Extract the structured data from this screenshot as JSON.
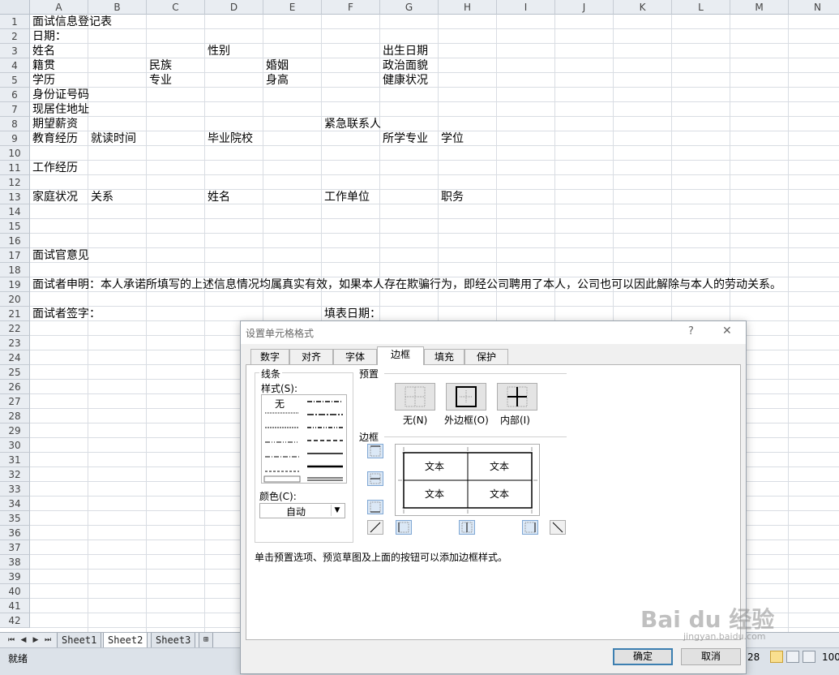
{
  "columns": [
    "A",
    "B",
    "C",
    "D",
    "E",
    "F",
    "G",
    "H",
    "I",
    "J",
    "K",
    "L",
    "M",
    "N"
  ],
  "rows": [
    "1",
    "2",
    "3",
    "4",
    "5",
    "6",
    "7",
    "8",
    "9",
    "10",
    "11",
    "12",
    "13",
    "14",
    "15",
    "16",
    "17",
    "18",
    "19",
    "20",
    "21",
    "22",
    "23",
    "24",
    "25",
    "26",
    "27",
    "28",
    "29",
    "30",
    "31",
    "32",
    "33",
    "34",
    "35",
    "36",
    "37",
    "38",
    "39",
    "40",
    "41",
    "42"
  ],
  "cells": [
    {
      "r": 1,
      "c": "A",
      "v": "面试信息登记表"
    },
    {
      "r": 2,
      "c": "A",
      "v": "日期："
    },
    {
      "r": 3,
      "c": "A",
      "v": "姓名"
    },
    {
      "r": 3,
      "c": "D",
      "v": "性别"
    },
    {
      "r": 3,
      "c": "G",
      "v": "出生日期"
    },
    {
      "r": 4,
      "c": "A",
      "v": "籍贯"
    },
    {
      "r": 4,
      "c": "C",
      "v": "民族"
    },
    {
      "r": 4,
      "c": "E",
      "v": "婚姻"
    },
    {
      "r": 4,
      "c": "G",
      "v": "政治面貌"
    },
    {
      "r": 5,
      "c": "A",
      "v": "学历"
    },
    {
      "r": 5,
      "c": "C",
      "v": "专业"
    },
    {
      "r": 5,
      "c": "E",
      "v": "身高"
    },
    {
      "r": 5,
      "c": "G",
      "v": "健康状况"
    },
    {
      "r": 6,
      "c": "A",
      "v": "身份证号码"
    },
    {
      "r": 7,
      "c": "A",
      "v": "现居住地址"
    },
    {
      "r": 8,
      "c": "A",
      "v": "期望薪资"
    },
    {
      "r": 8,
      "c": "F",
      "v": "紧急联系人"
    },
    {
      "r": 9,
      "c": "A",
      "v": "教育经历"
    },
    {
      "r": 9,
      "c": "B",
      "v": "就读时间"
    },
    {
      "r": 9,
      "c": "D",
      "v": "毕业院校"
    },
    {
      "r": 9,
      "c": "G",
      "v": "所学专业"
    },
    {
      "r": 9,
      "c": "H",
      "v": "学位"
    },
    {
      "r": 11,
      "c": "A",
      "v": "工作经历"
    },
    {
      "r": 13,
      "c": "A",
      "v": "家庭状况"
    },
    {
      "r": 13,
      "c": "B",
      "v": "关系"
    },
    {
      "r": 13,
      "c": "D",
      "v": "姓名"
    },
    {
      "r": 13,
      "c": "F",
      "v": "工作单位"
    },
    {
      "r": 13,
      "c": "H",
      "v": "职务"
    },
    {
      "r": 17,
      "c": "A",
      "v": "面试官意见"
    },
    {
      "r": 19,
      "c": "A",
      "v": "面试者申明：本人承诺所填写的上述信息情况均属真实有效，如果本人存在欺骗行为，即经公司聘用了本人，公司也可以因此解除与本人的劳动关系。"
    },
    {
      "r": 21,
      "c": "A",
      "v": "面试者签字："
    },
    {
      "r": 21,
      "c": "F",
      "v": "填表日期："
    }
  ],
  "sheet_tabs": [
    "Sheet1",
    "Sheet2",
    "Sheet3"
  ],
  "active_sheet": "Sheet2",
  "status": {
    "ready": "就绪",
    "zoom_partial": "28",
    "zoom_right": "100"
  },
  "dialog": {
    "title": "设置单元格格式",
    "help": "?",
    "close": "✕",
    "tabs": [
      "数字",
      "对齐",
      "字体",
      "边框",
      "填充",
      "保护"
    ],
    "active_tab": "边框",
    "line_group": "线条",
    "style_label": "样式(S):",
    "style_none": "无",
    "color_label": "颜色(C):",
    "color_value": "自动",
    "preset_group": "预置",
    "preset_none": "无(N)",
    "preset_outline": "外边框(O)",
    "preset_inside": "内部(I)",
    "border_group": "边框",
    "preview_text": "文本",
    "hint": "单击预置选项、预览草图及上面的按钮可以添加边框样式。",
    "ok": "确定",
    "cancel": "取消"
  },
  "watermark": "Bai du 经验",
  "watermark_url": "jingyan.baidu.com"
}
